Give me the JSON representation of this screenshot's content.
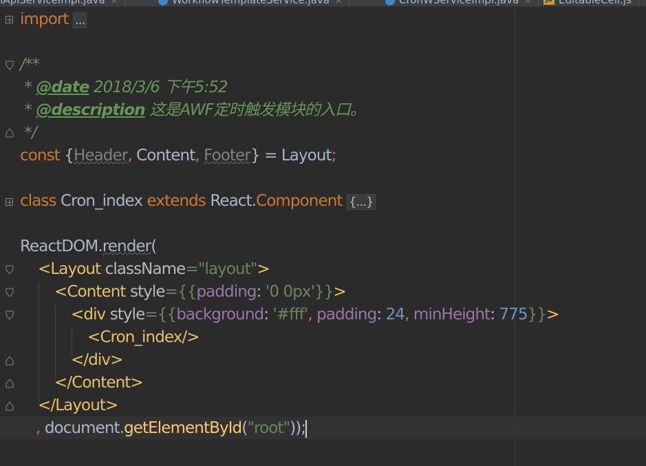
{
  "tabs": [
    {
      "label": "BpmApiServiceImpl.java",
      "icon": "java-class-icon"
    },
    {
      "label": "WorkflowTemplateService.java",
      "icon": "java-class-icon"
    },
    {
      "label": "CronWServiceImpl.java",
      "icon": "java-class-icon"
    },
    {
      "label": "EditableCell.js",
      "icon": "js-file-icon"
    }
  ],
  "code": {
    "import_kw": "import",
    "import_folded": "...",
    "comment_open": "/**",
    "date_prefix": " * ",
    "date_tag": "@date",
    "date_value": " 2018/3/6 下午5:52",
    "desc_prefix": " * ",
    "desc_tag": "@description",
    "desc_value": " 这是AWF定时触发模块的入口。",
    "comment_close": " */",
    "const_kw": "const",
    "brace_open": " {",
    "header": "Header",
    "comma1": ", ",
    "content": "Content",
    "comma2": ", ",
    "footer": "Footer",
    "brace_close": "} = Layout",
    "semi": ";",
    "class_kw": "class",
    "class_name": " Cron_index ",
    "extends_kw": "extends",
    "react": " React.",
    "component": "Component",
    "class_folded": "{...}",
    "reactdom": "ReactDOM.",
    "render": "render",
    "paren_open": "(",
    "layout_open_tag": "<Layout ",
    "layout_attr": "className",
    "layout_eq": "=",
    "layout_val": "\"layout\"",
    "layout_gt": ">",
    "content_open_tag": "<Content ",
    "content_attr": "style",
    "content_eq": "={{",
    "content_prop": "padding",
    "content_colon": ": ",
    "content_val": "'0 0px'",
    "content_close": "}}",
    "content_gt": ">",
    "div_open_tag": "<div ",
    "div_attr": "style",
    "div_eq": "={{",
    "div_prop1": "background",
    "div_colon1": ": ",
    "div_val1": "'#fff'",
    "div_comma1": ", ",
    "div_prop2": "padding",
    "div_colon2": ": ",
    "div_val2": "24",
    "div_comma2": ", ",
    "div_prop3": "minHeight",
    "div_colon3": ": ",
    "div_val3": "775",
    "div_close": "}}",
    "div_gt": ">",
    "cron_tag": "<Cron_index/>",
    "div_end_tag": "</div>",
    "content_end_tag": "</Content>",
    "layout_end_tag": "</Layout>",
    "last_comma": ", ",
    "document": "document.",
    "get_by_id": "getElementById",
    "arg_open": "(",
    "root": "\"root\"",
    "end": "));"
  },
  "colors": {
    "background": "#2b2b2b",
    "keyword": "#cc7832",
    "string": "#6a8759",
    "number": "#6897bb",
    "property": "#9876aa",
    "tag": "#e8bf6a",
    "comment": "#629755",
    "function": "#ffc66d",
    "text": "#a9b7c6"
  }
}
